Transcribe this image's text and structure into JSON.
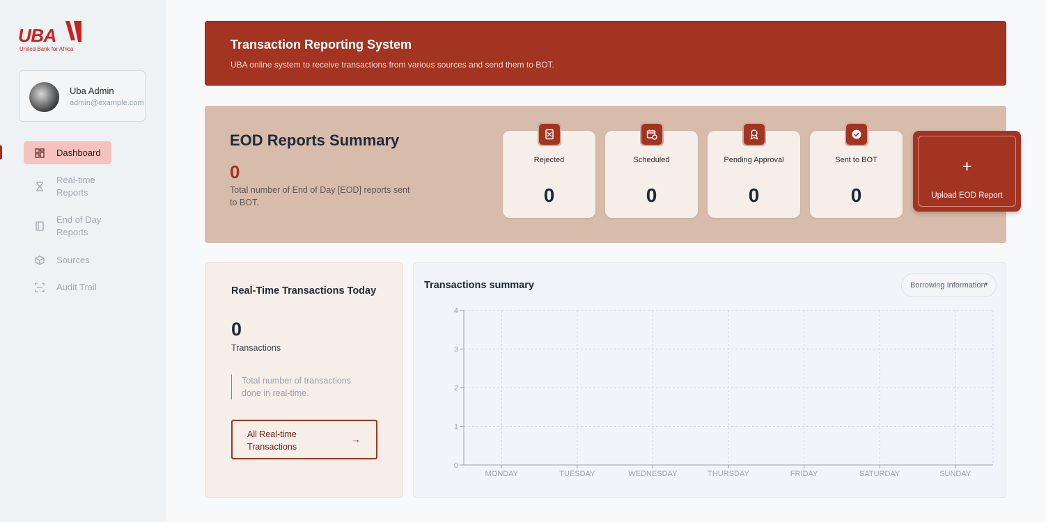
{
  "brand": {
    "logo_text": "UBA",
    "logo_sub": "United Bank for Africa",
    "accent": "#a23421"
  },
  "user": {
    "name": "Uba Admin",
    "email": "admin@example.com"
  },
  "nav": {
    "items": [
      {
        "label": "Dashboard",
        "icon": "grid-icon",
        "active": true
      },
      {
        "label": "Real-time Reports",
        "icon": "hourglass-icon"
      },
      {
        "label": "End of Day Reports",
        "icon": "book-icon"
      },
      {
        "label": "Sources",
        "icon": "package-icon"
      },
      {
        "label": "Audit Trail",
        "icon": "scan-icon"
      }
    ]
  },
  "banner": {
    "title": "Transaction Reporting System",
    "subtitle": "UBA online system to receive transactions from various sources and send them to BOT."
  },
  "eod": {
    "title": "EOD Reports Summary",
    "count": "0",
    "description": "Total number of End of Day [EOD] reports sent to BOT.",
    "stats": [
      {
        "label": "Rejected",
        "value": "0",
        "icon": "rejected-doc-icon"
      },
      {
        "label": "Scheduled",
        "value": "0",
        "icon": "calendar-clock-icon"
      },
      {
        "label": "Pending Approval",
        "value": "0",
        "icon": "award-icon"
      },
      {
        "label": "Sent to BOT",
        "value": "0",
        "icon": "check-badge-icon"
      }
    ],
    "upload": {
      "icon": "plus-icon",
      "label": "Upload EOD Report"
    }
  },
  "realtime": {
    "title": "Real-Time Transactions Today",
    "count": "0",
    "count_label": "Transactions",
    "note": "Total number of transactions done in real-time.",
    "button_label": "All Real-time Transactions",
    "button_icon": "arrow-right-icon"
  },
  "chart": {
    "title": "Transactions summary",
    "filter": {
      "selected": "Borrowing Information",
      "icon": "chevron-down-icon"
    }
  },
  "chart_data": {
    "type": "line",
    "title": "Transactions summary",
    "categories": [
      "MONDAY",
      "TUESDAY",
      "WEDNESDAY",
      "THURSDAY",
      "FRIDAY",
      "SATURDAY",
      "SUNDAY"
    ],
    "series": [],
    "yticks": [
      0,
      1,
      2,
      3,
      4
    ],
    "ylim": [
      0,
      4
    ],
    "grid": true,
    "xlabel": "",
    "ylabel": ""
  }
}
